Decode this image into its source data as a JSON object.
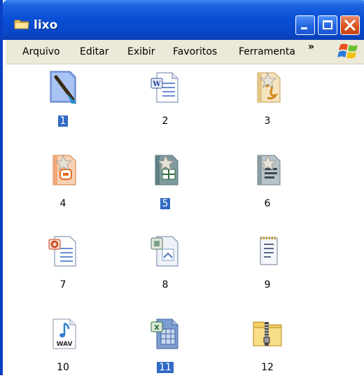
{
  "window": {
    "title": "lixo"
  },
  "menu": {
    "items": [
      "Arquivo",
      "Editar",
      "Exibir",
      "Favoritos",
      "Ferramenta"
    ],
    "overflow": "»"
  },
  "files": [
    {
      "label": "1",
      "icon": "paint-brush-icon",
      "selected": true
    },
    {
      "label": "2",
      "icon": "word-document-icon",
      "selected": false
    },
    {
      "label": "3",
      "icon": "drawing-document-icon",
      "selected": false
    },
    {
      "label": "4",
      "icon": "presentation-template-icon",
      "selected": false
    },
    {
      "label": "5",
      "icon": "spreadsheet-template-icon",
      "selected": true
    },
    {
      "label": "6",
      "icon": "text-template-icon",
      "selected": false
    },
    {
      "label": "7",
      "icon": "presentation-document-icon",
      "selected": false
    },
    {
      "label": "8",
      "icon": "office-document-icon",
      "selected": false
    },
    {
      "label": "9",
      "icon": "notepad-icon",
      "selected": false
    },
    {
      "label": "10",
      "icon": "wav-audio-icon",
      "selected": false
    },
    {
      "label": "11",
      "icon": "excel-spreadsheet-icon",
      "selected": true
    },
    {
      "label": "12",
      "icon": "zip-folder-icon",
      "selected": false
    }
  ],
  "colors": {
    "titlebar": "#0a4fd6",
    "selection": "#316ac5",
    "menubar": "#ece9d8"
  }
}
